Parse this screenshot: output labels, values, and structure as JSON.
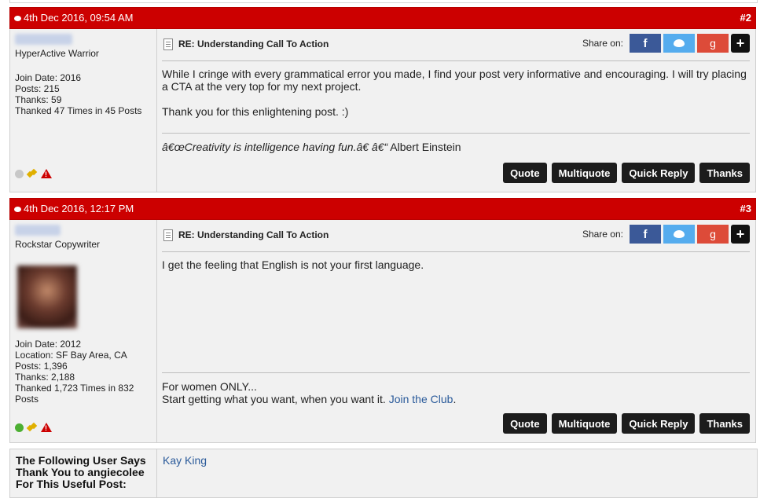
{
  "posts": [
    {
      "date": "4th Dec 2016, 09:54 AM",
      "number": "#2",
      "username": "dasrosedarod",
      "usertitle": "HyperActive Warrior",
      "stats": [
        "Join Date: 2016",
        "Posts: 215",
        "Thanks: 59",
        "Thanked 47 Times in 45 Posts"
      ],
      "status_color": "#c8c8c8",
      "title": "RE: Understanding Call To Action",
      "share_label": "Share on:",
      "message": [
        "While I cringe with every grammatical error you made, I find your post very informative and encouraging. I will try placing a CTA at the very top for my next project.",
        "Thank you for this enlightening post. :)"
      ],
      "signature": {
        "quote": "â€œCreativity is intelligence having fun.â€ â€“",
        "author": " Albert Einstein"
      },
      "actions": [
        "Quote",
        "Multiquote",
        "Quick Reply",
        "Thanks"
      ]
    },
    {
      "date": "4th Dec 2016, 12:17 PM",
      "number": "#3",
      "username": "angiecolee",
      "usertitle": "Rockstar Copywriter",
      "stats": [
        "Join Date: 2012",
        "Location: SF Bay Area, CA",
        "Posts: 1,396",
        "Thanks: 2,188",
        "Thanked 1,723 Times in 832 Posts"
      ],
      "status_color": "#4caf32",
      "title": "RE: Understanding Call To Action",
      "share_label": "Share on:",
      "message": [
        "I get the feeling that English is not your first language."
      ],
      "signature": {
        "line1": "For women ONLY...",
        "line2_pre": "Start getting what you want, when you want it. ",
        "link": "Join the Club",
        "line2_post": "."
      },
      "actions": [
        "Quote",
        "Multiquote",
        "Quick Reply",
        "Thanks"
      ]
    }
  ],
  "share_icons": {
    "facebook": "f",
    "google": "g",
    "plus": "+"
  },
  "thanks": {
    "label": "The Following User Says Thank You to angiecolee For This Useful Post:",
    "users": [
      "Kay King"
    ]
  },
  "colors": {
    "header_red": "#cc0000",
    "link": "#2a5a9a",
    "button_dark": "#1c1c1c"
  }
}
